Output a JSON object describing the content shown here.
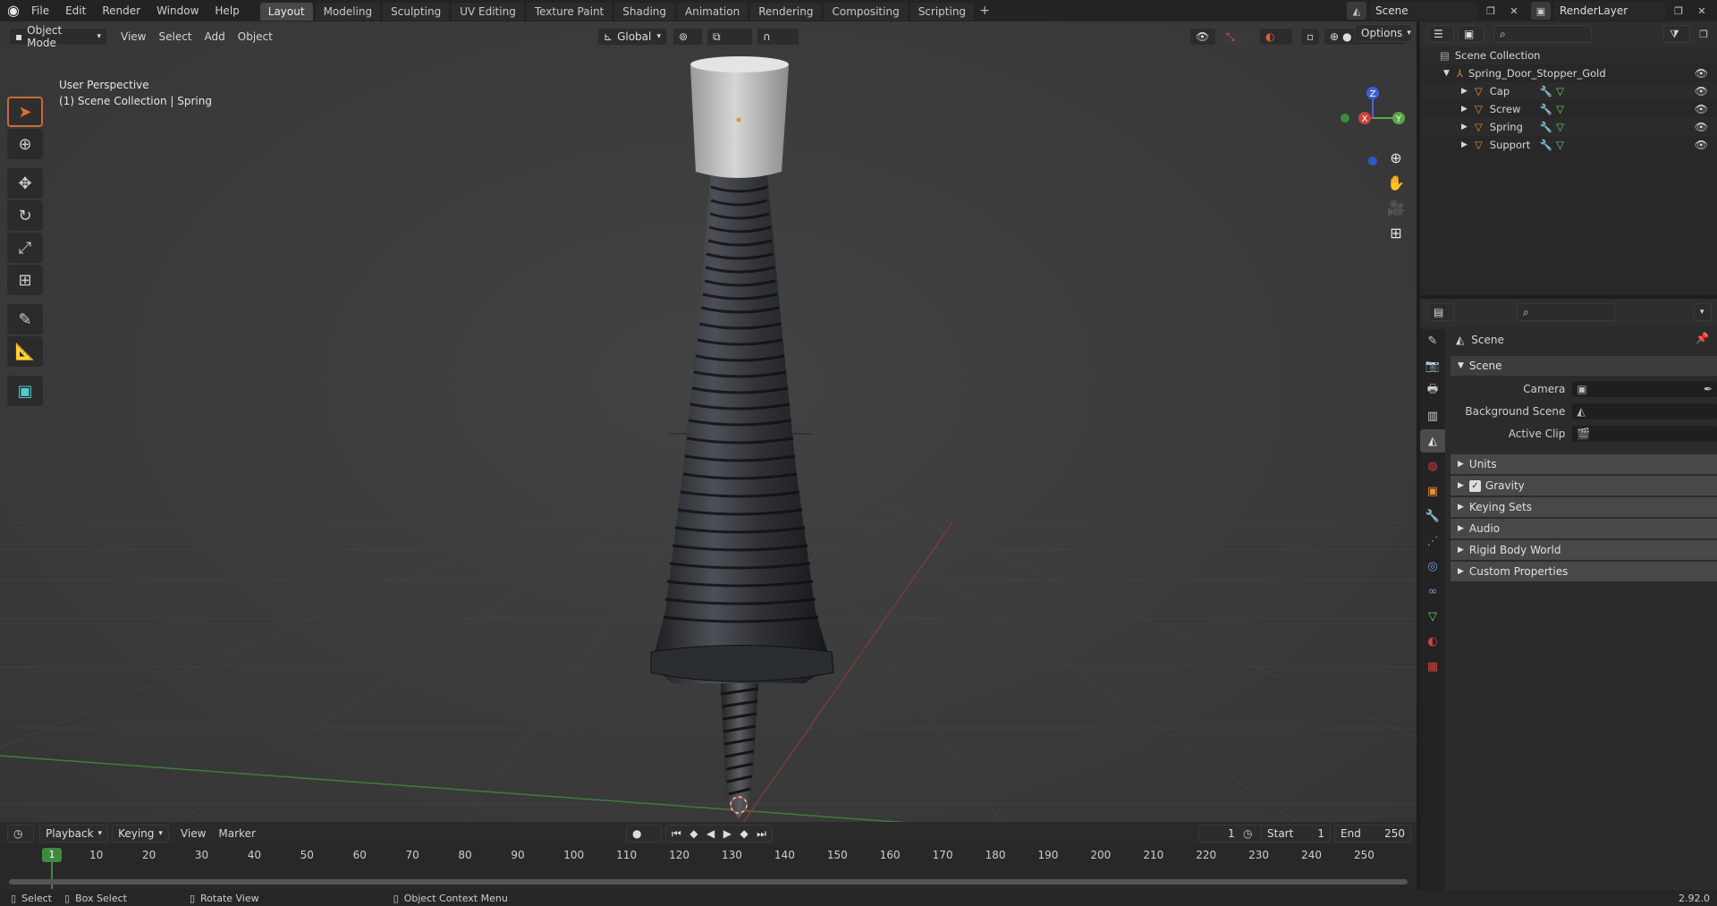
{
  "menubar": {
    "items": [
      "File",
      "Edit",
      "Render",
      "Window",
      "Help"
    ],
    "workspaces": [
      "Layout",
      "Modeling",
      "Sculpting",
      "UV Editing",
      "Texture Paint",
      "Shading",
      "Animation",
      "Rendering",
      "Compositing",
      "Scripting"
    ],
    "active_workspace": "Layout",
    "add_tab_icon": "+",
    "scene_name": "Scene",
    "render_layer": "RenderLayer"
  },
  "viewport": {
    "mode": "Object Mode",
    "menus": [
      "View",
      "Select",
      "Add",
      "Object"
    ],
    "transform_orientation": "Global",
    "options_label": "Options",
    "perspective": "User Perspective",
    "collection_info": "(1) Scene Collection | Spring",
    "gizmo": {
      "x": "X",
      "y": "Y",
      "z": "Z"
    },
    "tools": [
      "select-box-tool",
      "cursor-tool",
      "move-tool",
      "rotate-tool",
      "scale-tool",
      "transform-tool",
      "annotate-tool",
      "measure-tool",
      "add-cube-tool"
    ]
  },
  "outliner": {
    "root": "Scene Collection",
    "collection": "Spring_Door_Stopper_Gold",
    "objects": [
      "Cap",
      "Screw",
      "Spring",
      "Support"
    ]
  },
  "properties": {
    "context_title": "Scene",
    "panel_title": "Scene",
    "fields": [
      {
        "label": "Camera",
        "value": ""
      },
      {
        "label": "Background Scene",
        "value": ""
      },
      {
        "label": "Active Clip",
        "value": ""
      }
    ],
    "sections": [
      "Units",
      "Gravity",
      "Keying Sets",
      "Audio",
      "Rigid Body World",
      "Custom Properties"
    ],
    "gravity_checked": true,
    "tab_icons": [
      "tool",
      "render",
      "output",
      "view-layer",
      "scene",
      "world",
      "object",
      "modifiers",
      "particles",
      "physics",
      "constraints",
      "data",
      "material",
      "texture"
    ]
  },
  "timeline": {
    "menus": [
      "Playback",
      "Keying",
      "View",
      "Marker"
    ],
    "current_frame": "1",
    "start_label": "Start",
    "start": "1",
    "end_label": "End",
    "end": "250",
    "ticks": [
      "10",
      "20",
      "30",
      "40",
      "50",
      "60",
      "70",
      "80",
      "90",
      "100",
      "110",
      "120",
      "130",
      "140",
      "150",
      "160",
      "170",
      "180",
      "190",
      "200",
      "210",
      "220",
      "230",
      "240",
      "250"
    ],
    "playhead": "1"
  },
  "statusbar": {
    "select": "Select",
    "box_select": "Box Select",
    "rotate_view": "Rotate View",
    "context_menu": "Object Context Menu",
    "version": "2.92.0"
  }
}
